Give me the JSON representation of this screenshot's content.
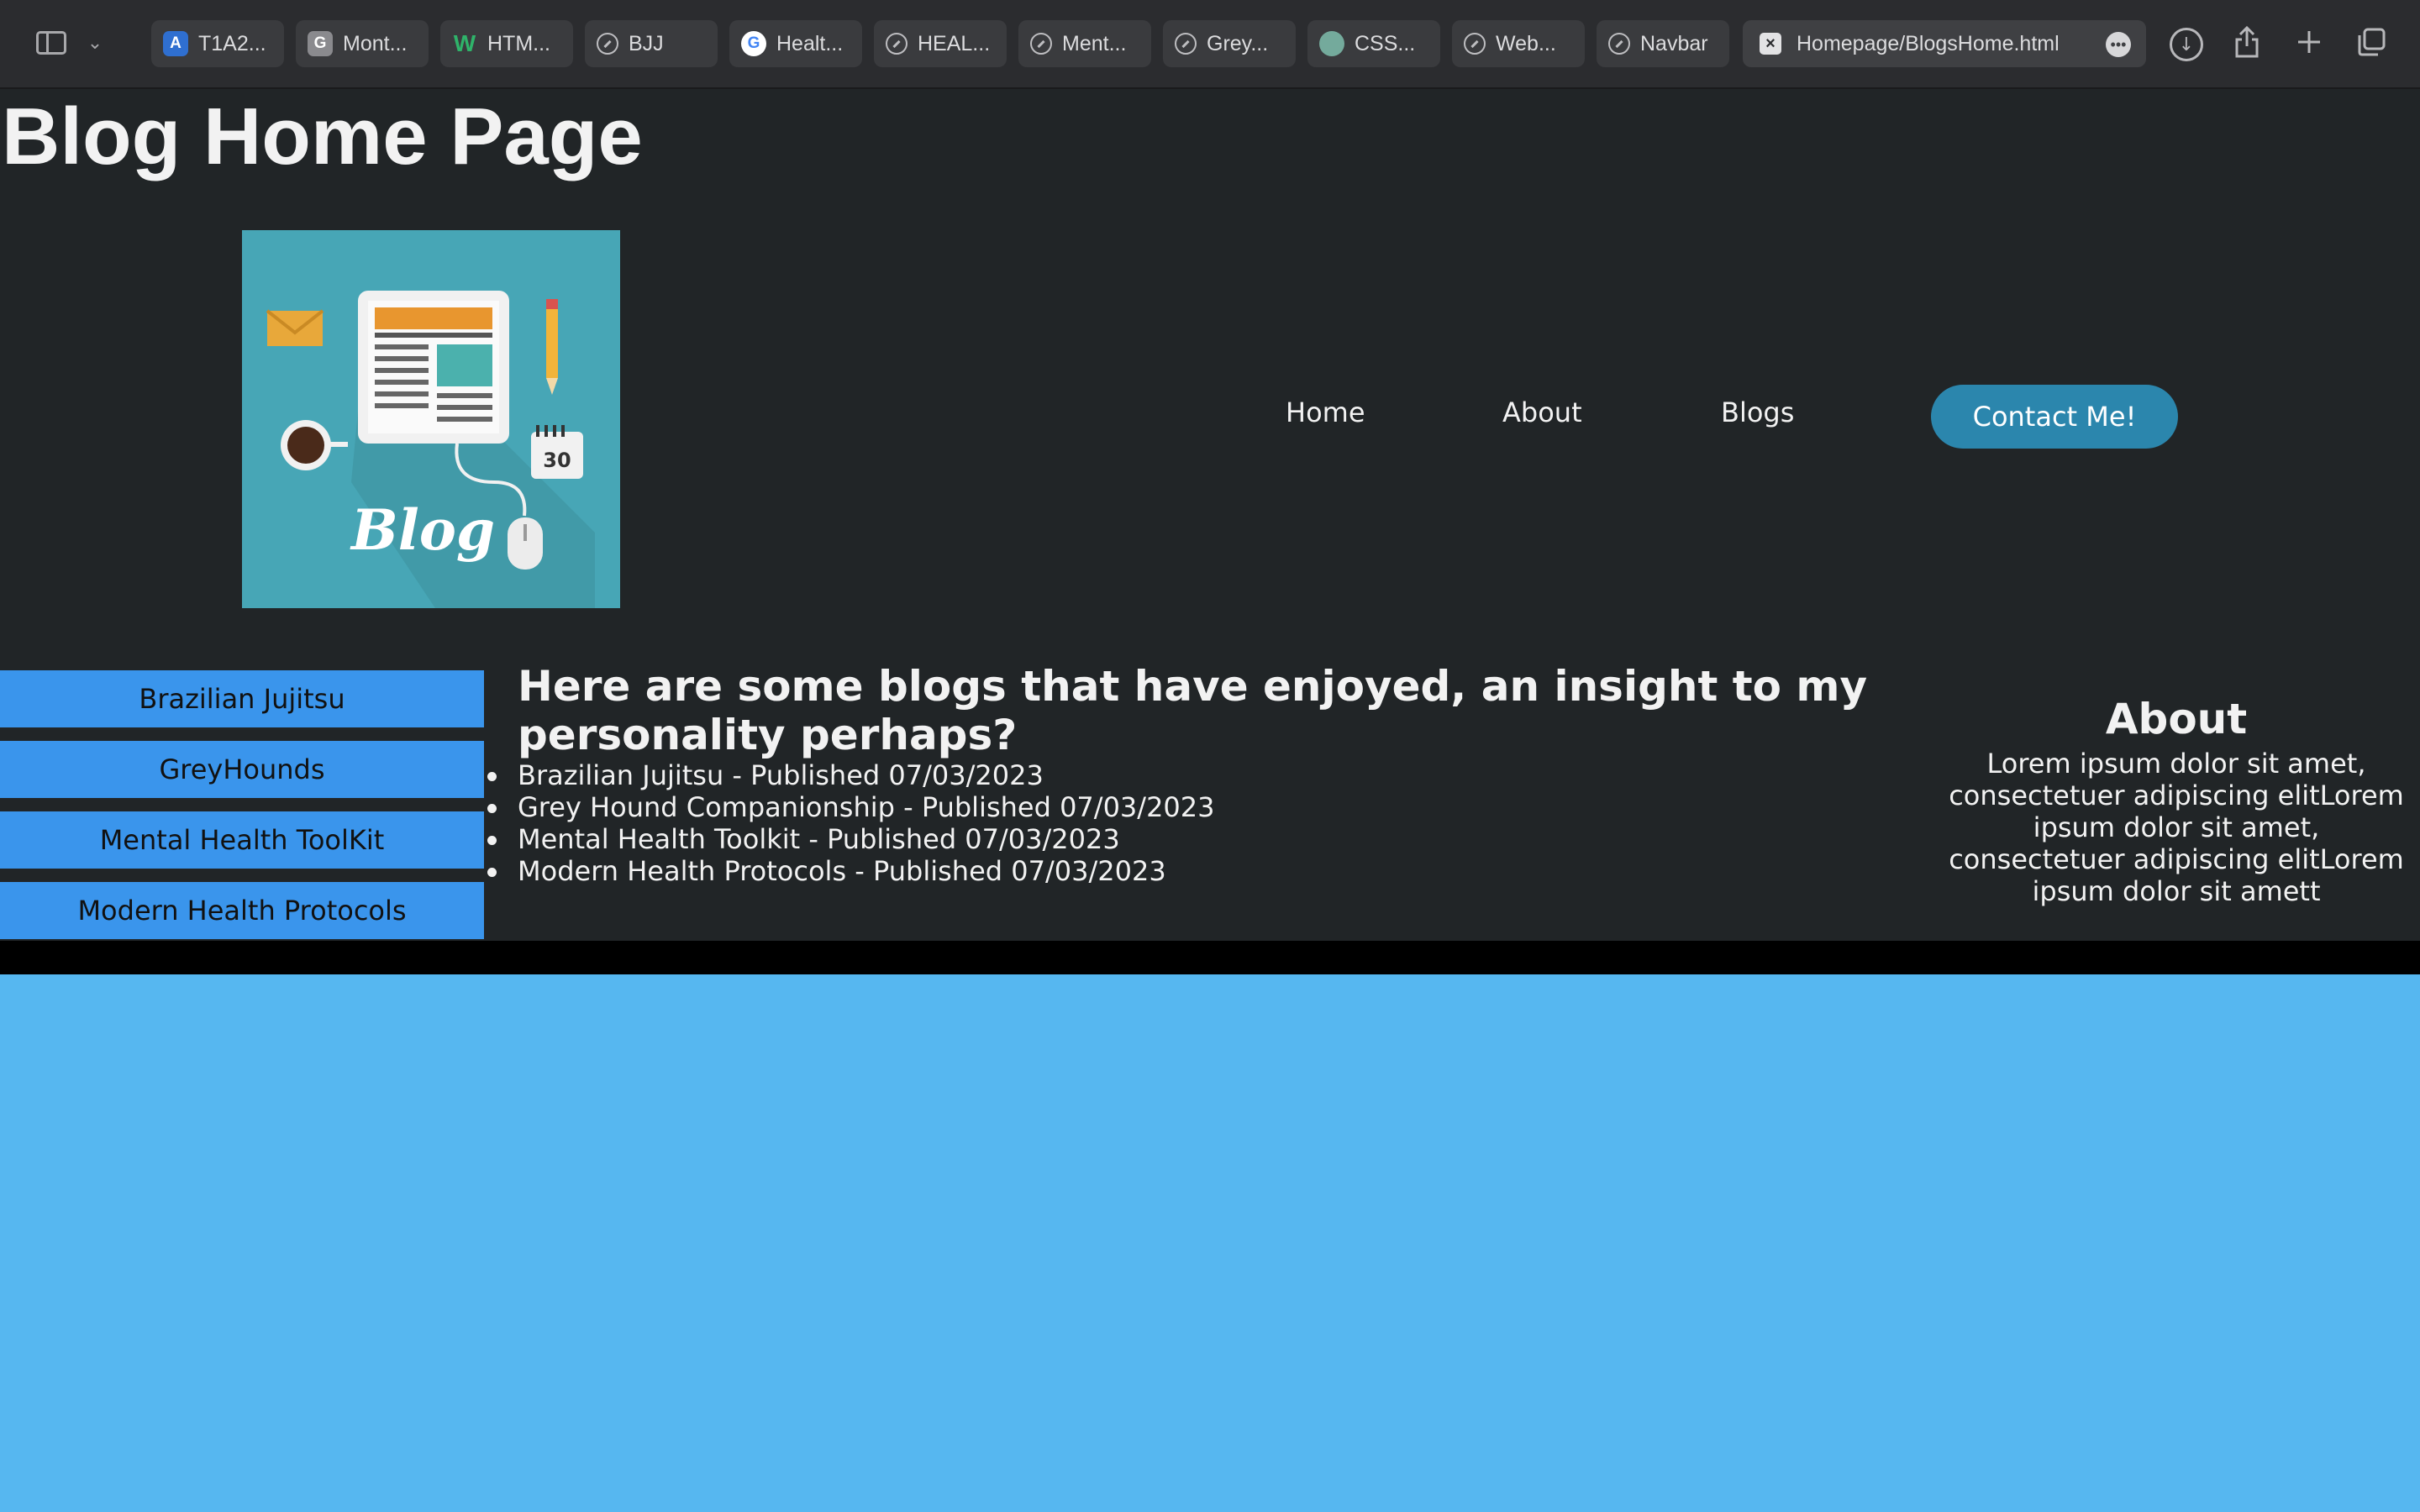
{
  "browser": {
    "tabs": [
      {
        "label": "T1A2...",
        "favicon": "t1-icon"
      },
      {
        "label": "Mont...",
        "favicon": "g-icon"
      },
      {
        "label": "HTM...",
        "favicon": "w-icon"
      },
      {
        "label": "BJJ",
        "favicon": "compass-icon"
      },
      {
        "label": "Healt...",
        "favicon": "google-icon"
      },
      {
        "label": "HEAL...",
        "favicon": "compass-icon"
      },
      {
        "label": "Ment...",
        "favicon": "compass-icon"
      },
      {
        "label": "Grey...",
        "favicon": "compass-icon"
      },
      {
        "label": "CSS...",
        "favicon": "openai-icon"
      },
      {
        "label": "Web...",
        "favicon": "compass-icon"
      },
      {
        "label": "Navbar",
        "favicon": "compass-icon"
      }
    ],
    "active_tab": {
      "label": "Homepage/BlogsHome.html"
    }
  },
  "page": {
    "title": "Blog Home Page",
    "logo_text": "Blog",
    "logo_calendar_day": "30",
    "nav": {
      "home": "Home",
      "about": "About",
      "blogs": "Blogs",
      "contact": "Contact Me!"
    },
    "sidebar": [
      {
        "label": "Brazilian Jujitsu"
      },
      {
        "label": "GreyHounds"
      },
      {
        "label": "Mental Health ToolKit"
      },
      {
        "label": "Modern Health Protocols"
      }
    ],
    "main": {
      "heading": "Here are some blogs that have enjoyed, an insight to my personality perhaps?",
      "posts": [
        {
          "text": "Brazilian Jujitsu - Published 07/03/2023"
        },
        {
          "text": "Grey Hound Companionship - Published 07/03/2023"
        },
        {
          "text": "Mental Health Toolkit - Published 07/03/2023"
        },
        {
          "text": "Modern Health Protocols - Published 07/03/2023"
        }
      ]
    },
    "about": {
      "heading": "About",
      "body": "Lorem ipsum dolor sit amet, consectetuer adipiscing elitLorem ipsum dolor sit amet, consectetuer adipiscing elitLorem ipsum dolor sit amett"
    }
  },
  "colors": {
    "header_bg": "#212527",
    "page_bg": "#56b7f0",
    "sidebar_button": "#3a95ec",
    "contact_button": "#2b86ad",
    "divider": "#000000"
  }
}
